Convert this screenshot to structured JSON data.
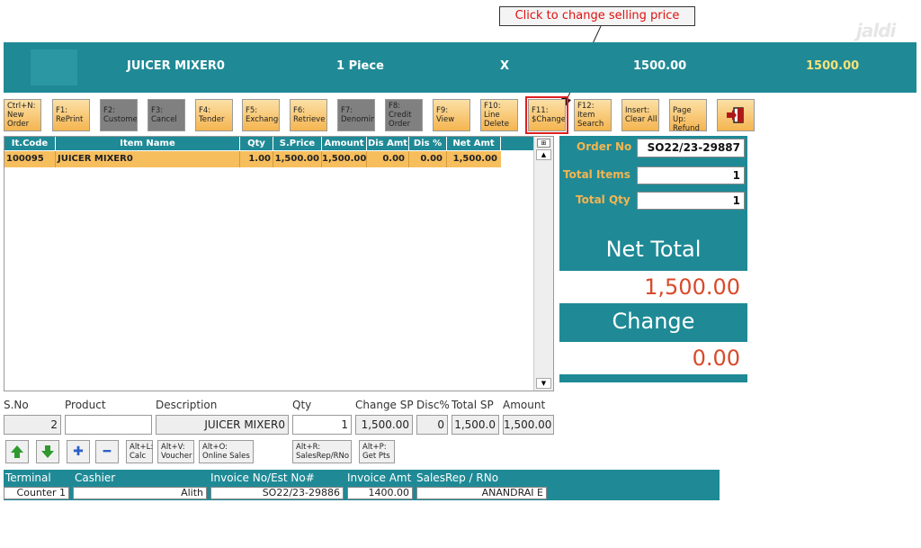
{
  "callout": {
    "text": "Click to change selling price"
  },
  "logo": {
    "text": "jaldi"
  },
  "banner": {
    "item_name": "JUICER MIXER0",
    "qty": "1 Piece",
    "x": "X",
    "price": "1500.00",
    "total": "1500.00"
  },
  "toolbar": [
    {
      "key": "Ctrl+N:",
      "label": "New Order"
    },
    {
      "key": "F1:",
      "label": "RePrint"
    },
    {
      "key": "F2:",
      "label": "Customer"
    },
    {
      "key": "F3:",
      "label": "Cancel"
    },
    {
      "key": "F4:",
      "label": "Tender"
    },
    {
      "key": "F5:",
      "label": "Exchange"
    },
    {
      "key": "F6:",
      "label": "Retrieve"
    },
    {
      "key": "F7:",
      "label": "Denomina"
    },
    {
      "key": "F8:",
      "label": "Credit Order"
    },
    {
      "key": "F9:",
      "label": "View"
    },
    {
      "key": "F10:",
      "label": "Line Delete"
    },
    {
      "key": "F11:",
      "label": "$Change"
    },
    {
      "key": "F12:",
      "label": "Item Search"
    },
    {
      "key": "Insert:",
      "label": "Clear All"
    },
    {
      "key": "Page Up:",
      "label": "Refund"
    }
  ],
  "grid": {
    "headers": [
      "It.Code",
      "Item Name",
      "Qty",
      "S.Price",
      "Amount",
      "Dis Amt",
      "Dis %",
      "Net Amt"
    ],
    "rows": [
      [
        "100095",
        "JUICER MIXER0",
        "1.00",
        "1,500.00",
        "1,500.00",
        "0.00",
        "0.00",
        "1,500.00"
      ]
    ]
  },
  "summary": {
    "order_label": "Order No",
    "order_no": "SO22/23-29887",
    "items_label": "Total Items",
    "items": "1",
    "qty_label": "Total Qty",
    "qty": "1",
    "net_label": "Net Total",
    "net": "1,500.00",
    "change_label": "Change",
    "change": "0.00"
  },
  "entry": {
    "labels": [
      "S.No",
      "Product",
      "Description",
      "Qty",
      "Change SP",
      "Disc%",
      "Total SP",
      "Amount"
    ],
    "values": [
      "2",
      "",
      "JUICER MIXER0",
      "1",
      "1,500.00",
      "0",
      "1,500.0",
      "1,500.00"
    ]
  },
  "actions": {
    "calc": {
      "key": "Alt+L:",
      "label": "Calc"
    },
    "voucher": {
      "key": "Alt+V:",
      "label": "Voucher"
    },
    "online": {
      "key": "Alt+O:",
      "label": "Online Sales"
    },
    "salesrep": {
      "key": "Alt+R:",
      "label": "SalesRep/RNo"
    },
    "getpts": {
      "key": "Alt+P:",
      "label": "Get Pts"
    }
  },
  "footer": {
    "labels": [
      "Terminal",
      "Cashier",
      "Invoice No/Est No#",
      "Invoice Amt",
      "SalesRep / RNo"
    ],
    "values": [
      "Counter 1",
      "Alith",
      "SO22/23-29886",
      "1400.00",
      "ANANDRAI E"
    ]
  },
  "colors": {
    "teal": "#1f8a96",
    "orange": "#f5b550",
    "red": "#d84a2a"
  }
}
